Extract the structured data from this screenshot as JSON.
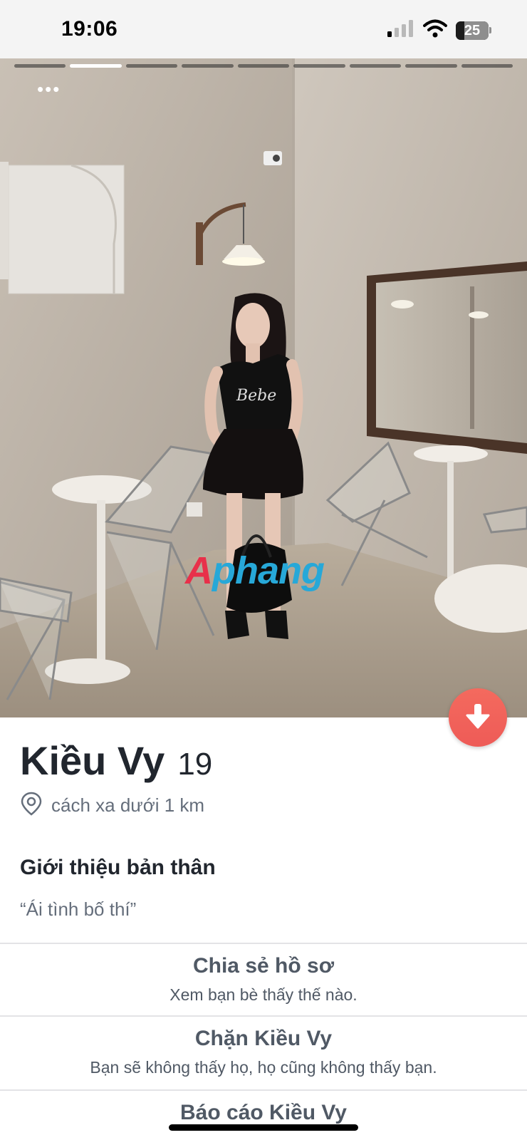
{
  "status_bar": {
    "time": "19:06",
    "battery": "25",
    "icons": [
      "cellular-signal-icon",
      "wifi-icon",
      "battery-icon"
    ]
  },
  "photo": {
    "total_photos": 9,
    "active_photo": 2,
    "watermark_part1": "A",
    "watermark_part2": "phang"
  },
  "profile": {
    "name": "Kiều Vy",
    "age": "19",
    "distance": "cách xa dưới 1 km"
  },
  "about": {
    "title": "Giới thiệu bản thân",
    "text": "“Ái tình bố thí”"
  },
  "actions": {
    "share_title": "Chia sẻ hồ sơ",
    "share_subtitle": "Xem bạn bè thấy thế nào.",
    "block_title": "Chặn Kiều Vy",
    "block_subtitle": "Bạn sẽ không thấy họ, họ cũng không thấy bạn.",
    "report_title": "Báo cáo Kiều Vy"
  },
  "colors": {
    "dislike_button": "#ef5f5a",
    "primary_text": "#21262e",
    "secondary_text": "#656e7b"
  }
}
